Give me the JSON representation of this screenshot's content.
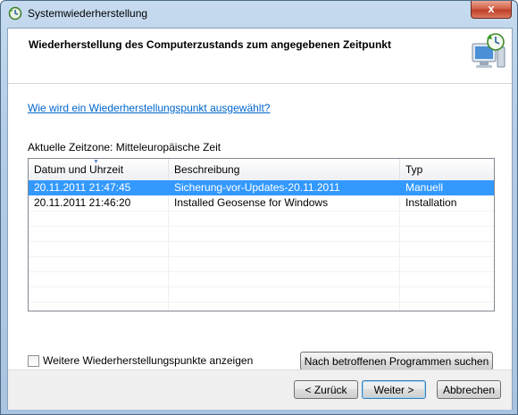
{
  "window": {
    "title": "Systemwiederherstellung",
    "close_label": "x",
    "icon": "system-restore-icon"
  },
  "header": {
    "title": "Wiederherstellung des Computerzustands zum angegebenen Zeitpunkt",
    "icon": "system-restore-computer-icon"
  },
  "help_link": "Wie wird ein Wiederherstellungspunkt ausgewählt?",
  "timezone_label": "Aktuelle Zeitzone: Mitteleuropäische Zeit",
  "list": {
    "columns": [
      "Datum und Uhrzeit",
      "Beschreibung",
      "Typ"
    ],
    "sort_column": "Datum und Uhrzeit",
    "rows": [
      {
        "date": "20.11.2011 21:47:45",
        "description": "Sicherung-vor-Updates-20.11.2011",
        "type": "Manuell",
        "selected": true
      },
      {
        "date": "20.11.2011 21:46:20",
        "description": "Installed Geosense for Windows",
        "type": "Installation",
        "selected": false
      }
    ]
  },
  "show_more_checkbox": {
    "label": "Weitere Wiederherstellungspunkte anzeigen",
    "checked": false
  },
  "scan_button": "Nach betroffenen Programmen suchen",
  "footer": {
    "back_label": "< Zurück",
    "next_label": "Weiter >",
    "cancel_label": "Abbrechen"
  },
  "colors": {
    "selection": "#3399ff",
    "link": "#0066cc",
    "close_button": "#c1402a"
  }
}
